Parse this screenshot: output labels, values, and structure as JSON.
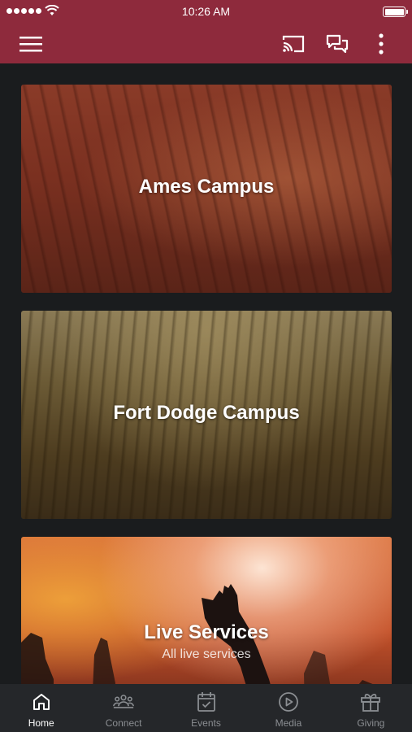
{
  "status_bar": {
    "time": "10:26 AM"
  },
  "header": {
    "menu_icon": "hamburger-menu-icon",
    "cast_icon": "cast-icon",
    "chat_icon": "chat-bubbles-icon",
    "more_icon": "more-vertical-icon",
    "background_color": "#8e2a3c"
  },
  "cards": [
    {
      "title": "Ames Campus",
      "subtitle": ""
    },
    {
      "title": "Fort Dodge Campus",
      "subtitle": ""
    },
    {
      "title": "Live Services",
      "subtitle": "All live services"
    }
  ],
  "bottom_nav": {
    "active_index": 0,
    "items": [
      {
        "label": "Home",
        "icon": "home-icon"
      },
      {
        "label": "Connect",
        "icon": "group-icon"
      },
      {
        "label": "Events",
        "icon": "calendar-check-icon"
      },
      {
        "label": "Media",
        "icon": "play-circle-icon"
      },
      {
        "label": "Giving",
        "icon": "gift-icon"
      }
    ]
  }
}
